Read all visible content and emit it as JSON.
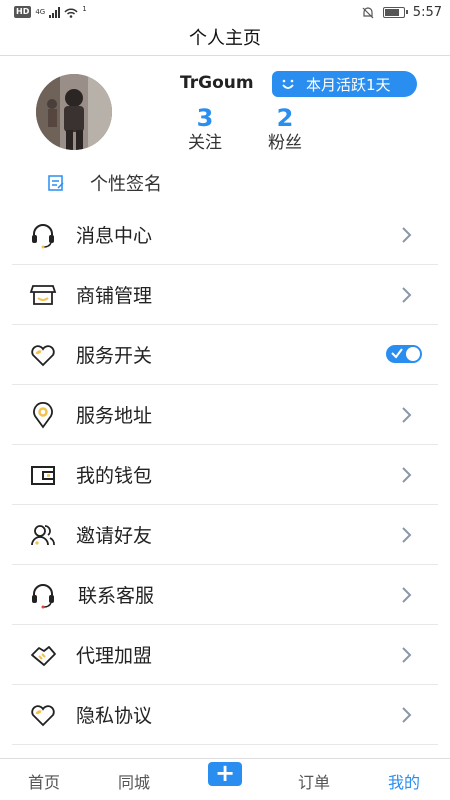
{
  "status_bar": {
    "hd": "HD",
    "network": "4G",
    "wifi_count": "1",
    "time": "5:57",
    "battery_level": 0.85
  },
  "header": {
    "title": "个人主页"
  },
  "profile": {
    "username": "TrGoum",
    "active_badge": "本月活跃1天",
    "following_count": "3",
    "following_label": "关注",
    "fans_count": "2",
    "fans_label": "粉丝",
    "signature_label": "个性签名"
  },
  "menu": {
    "items": [
      {
        "label": "消息中心",
        "icon": "headset-icon",
        "action": "chevron"
      },
      {
        "label": "商铺管理",
        "icon": "store-icon",
        "action": "chevron"
      },
      {
        "label": "服务开关",
        "icon": "heart-icon",
        "action": "toggle",
        "toggle_on": true
      },
      {
        "label": "服务地址",
        "icon": "location-pin-icon",
        "action": "chevron"
      },
      {
        "label": "我的钱包",
        "icon": "wallet-icon",
        "action": "chevron"
      },
      {
        "label": "邀请好友",
        "icon": "friends-icon",
        "action": "chevron"
      },
      {
        "label": "联系客服",
        "icon": "support-headset-icon",
        "action": "chevron"
      },
      {
        "label": "代理加盟",
        "icon": "handshake-icon",
        "action": "chevron"
      },
      {
        "label": "隐私协议",
        "icon": "privacy-heart-icon",
        "action": "chevron"
      }
    ]
  },
  "bottom_nav": {
    "home": "首页",
    "local": "同城",
    "add": "+",
    "orders": "订单",
    "mine": "我的"
  },
  "colors": {
    "accent": "#2a8ef0",
    "icon_gold": "#f2c14e"
  }
}
